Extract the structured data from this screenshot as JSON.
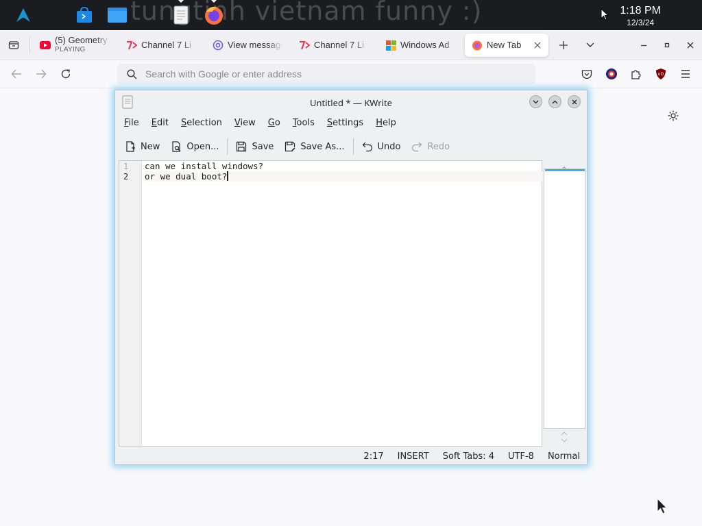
{
  "taskbar": {
    "wallpaper_text": "tungtinh vietnam funny :)",
    "launchers": [
      {
        "icon": "arch-linux-logo-icon"
      },
      {
        "icon": "software-store-icon"
      },
      {
        "icon": "file-manager-icon"
      },
      {
        "icon": "kwrite-app-icon",
        "active": true
      },
      {
        "icon": "firefox-app-icon",
        "active": true
      }
    ],
    "time": "1:18 PM",
    "date": "12/3/24"
  },
  "browser": {
    "tabs": [
      {
        "title": "(5) Geometry",
        "subtitle": "PLAYING",
        "icon": "youtube-icon",
        "color": "#ff0033"
      },
      {
        "title": "Channel 7 Li",
        "icon": "channel7-icon",
        "color": "#e63c5a"
      },
      {
        "title": "View message",
        "icon": "mail-at-icon",
        "color": "#6a5cff"
      },
      {
        "title": "Channel 7 Li",
        "icon": "channel7-icon",
        "color": "#e63c5a"
      },
      {
        "title": "Windows Ad",
        "icon": "windows-logo-icon",
        "color": "#2b7de9"
      },
      {
        "title": "New Tab",
        "icon": "firefox-icon",
        "color": "#ff7139",
        "selected": true
      }
    ],
    "search_placeholder": "Search with Google or enter address"
  },
  "kwrite": {
    "title": "Untitled * — KWrite",
    "menu": [
      {
        "accel": "F",
        "rest": "ile"
      },
      {
        "accel": "E",
        "rest": "dit"
      },
      {
        "accel": "S",
        "rest": "election"
      },
      {
        "accel": "V",
        "rest": "iew"
      },
      {
        "accel": "G",
        "rest": "o"
      },
      {
        "accel": "T",
        "rest": "ools"
      },
      {
        "accel": "S",
        "rest": "ettings"
      },
      {
        "accel": "H",
        "rest": "elp"
      }
    ],
    "toolbar": {
      "new": "New",
      "open": "Open...",
      "save": "Save",
      "save_as": "Save As...",
      "undo": "Undo",
      "redo": "Redo"
    },
    "lines": [
      {
        "number": "1",
        "text": "can we install windows?"
      },
      {
        "number": "2",
        "text": "or we dual boot?",
        "current": true
      }
    ],
    "status": {
      "position": "2:17",
      "mode": "INSERT",
      "tabs": "Soft Tabs: 4",
      "encoding": "UTF-8",
      "input_mode": "Normal"
    }
  }
}
